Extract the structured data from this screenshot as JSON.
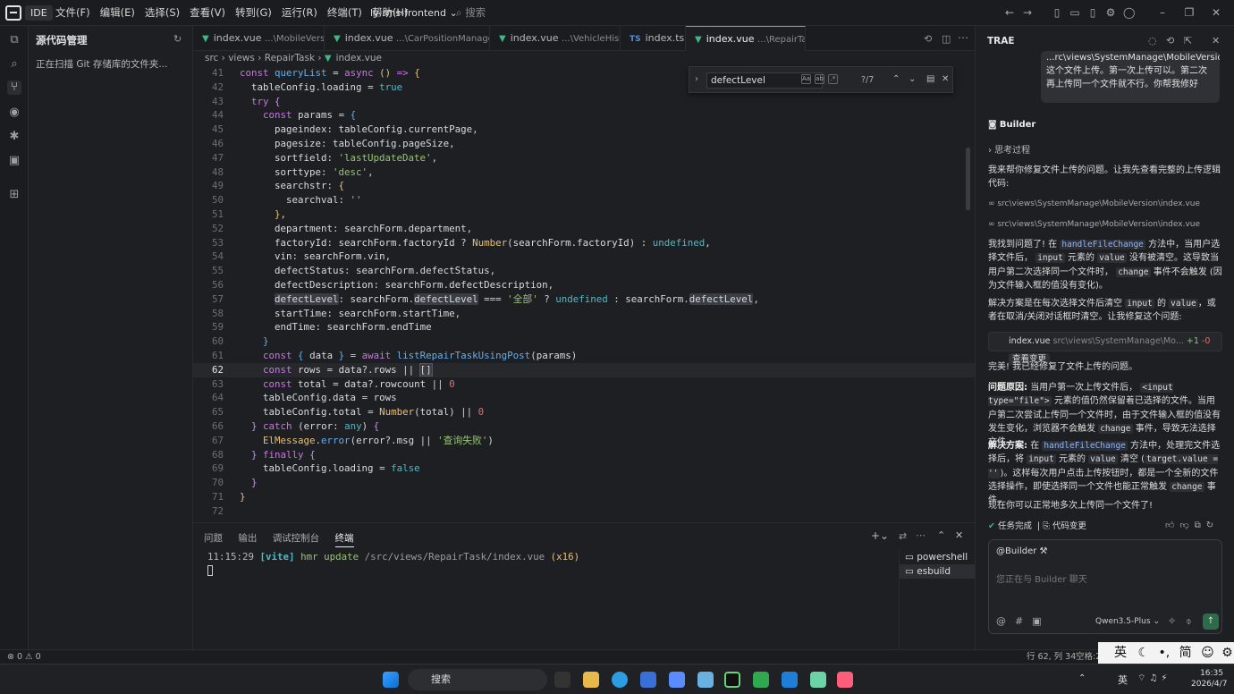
{
  "titlebar": {
    "badge": "IDE",
    "menu": [
      "文件(F)",
      "编辑(E)",
      "选择(S)",
      "查看(V)",
      "转到(G)",
      "运行(R)",
      "终端(T)",
      "帮助(H)"
    ],
    "project": "ly-rms-frontend",
    "search_placeholder": "搜索"
  },
  "sidebar": {
    "title": "源代码管理",
    "message": "正在扫描 Git 存储库的文件夹..."
  },
  "tabs": [
    {
      "name": "index.vue",
      "hint": "...\\MobileVersion",
      "type": "vue"
    },
    {
      "name": "index.vue",
      "hint": "...\\CarPositionManagement",
      "type": "vue"
    },
    {
      "name": "index.vue",
      "hint": "...\\VehicleHistory",
      "type": "vue"
    },
    {
      "name": "index.ts",
      "hint": "",
      "type": "ts"
    },
    {
      "name": "index.vue",
      "hint": "...\\RepairTask",
      "type": "vue",
      "active": true
    }
  ],
  "breadcrumb": [
    "src",
    "views",
    "RepairTask",
    "index.vue"
  ],
  "find": {
    "query": "defectLevel",
    "count": "?/7"
  },
  "editor": {
    "current_line": 62,
    "lines": [
      {
        "n": 41,
        "html": "<span class='k'>const</span> <span class='f'>queryList</span> <span class='p'>=</span> <span class='k'>async</span> <span class='v'>()</span> <span class='k'>=&gt;</span> <span class='v'>{</span>"
      },
      {
        "n": 42,
        "html": "  <span class='pr'>tableConfig</span>.<span class='pr'>loading</span> = <span class='b'>true</span>"
      },
      {
        "n": 43,
        "html": "  <span class='k'>try</span> <span class='u'>{</span>"
      },
      {
        "n": 44,
        "html": "    <span class='k'>const</span> <span class='pr'>params</span> = <span class='f'>{</span>"
      },
      {
        "n": 45,
        "html": "      <span class='pr'>pageindex</span>: <span class='pr'>tableConfig</span>.<span class='pr'>currentPage</span>,"
      },
      {
        "n": 46,
        "html": "      <span class='pr'>pagesize</span>: <span class='pr'>tableConfig</span>.<span class='pr'>pageSize</span>,"
      },
      {
        "n": 47,
        "html": "      <span class='pr'>sortfield</span>: <span class='s'>'lastUpdateDate'</span>,"
      },
      {
        "n": 48,
        "html": "      <span class='pr'>sorttype</span>: <span class='s'>'desc'</span>,"
      },
      {
        "n": 49,
        "html": "      <span class='pr'>searchstr</span>: <span class='v'>{</span>"
      },
      {
        "n": 50,
        "html": "        <span class='pr'>searchval</span>: <span class='s'>''</span>"
      },
      {
        "n": 51,
        "html": "      <span class='v'>}</span>,"
      },
      {
        "n": 52,
        "html": "      <span class='pr'>department</span>: <span class='pr'>searchForm</span>.<span class='pr'>department</span>,"
      },
      {
        "n": 53,
        "html": "      <span class='pr'>factoryId</span>: <span class='pr'>searchForm</span>.<span class='pr'>factoryId</span> ? <span class='v'>Number</span>(<span class='pr'>searchForm</span>.<span class='pr'>factoryId</span>) : <span class='b'>undefined</span>,"
      },
      {
        "n": 54,
        "html": "      <span class='pr'>vin</span>: <span class='pr'>searchForm</span>.<span class='pr'>vin</span>,"
      },
      {
        "n": 55,
        "html": "      <span class='pr'>defectStatus</span>: <span class='pr'>searchForm</span>.<span class='pr'>defectStatus</span>,"
      },
      {
        "n": 56,
        "html": "      <span class='pr'>defectDescription</span>: <span class='pr'>searchForm</span>.<span class='pr'>defectDescription</span>,"
      },
      {
        "n": 57,
        "html": "      <span class='pr hl'>defectLevel</span>: <span class='pr'>searchForm</span>.<span class='pr hl'>defectLevel</span> === <span class='s'>'全部'</span> ? <span class='b'>undefined</span> : <span class='pr'>searchForm</span>.<span class='pr hl'>defectLevel</span>,"
      },
      {
        "n": 58,
        "html": "      <span class='pr'>startTime</span>: <span class='pr'>searchForm</span>.<span class='pr'>startTime</span>,"
      },
      {
        "n": 59,
        "html": "      <span class='pr'>endTime</span>: <span class='pr'>searchForm</span>.<span class='pr'>endTime</span>"
      },
      {
        "n": 60,
        "html": "    <span class='f'>}</span>"
      },
      {
        "n": 61,
        "html": "    <span class='k'>const</span> <span class='f'>{</span> <span class='pr'>data</span> <span class='f'>}</span> = <span class='k'>await</span> <span class='f'>listRepairTaskUsingPost</span>(<span class='pr'>params</span>)"
      },
      {
        "n": 62,
        "html": "    <span class='k'>const</span> <span class='pr'>rows</span> = <span class='pr'>data</span>?.<span class='pr'>rows</span> || <span class='hl2'>[]</span>"
      },
      {
        "n": 63,
        "html": "    <span class='k'>const</span> <span class='pr'>total</span> = <span class='pr'>data</span>?.<span class='pr'>rowcount</span> || <span class='n'>0</span>"
      },
      {
        "n": 64,
        "html": "    <span class='pr'>tableConfig</span>.<span class='pr'>data</span> = <span class='pr'>rows</span>"
      },
      {
        "n": 65,
        "html": "    <span class='pr'>tableConfig</span>.<span class='pr'>total</span> = <span class='v'>Number</span>(<span class='pr'>total</span>) || <span class='n'>0</span>"
      },
      {
        "n": 66,
        "html": "  <span class='u'>}</span> <span class='k'>catch</span> (<span class='pr'>error</span>: <span class='b'>any</span>) <span class='u'>{</span>"
      },
      {
        "n": 67,
        "html": "    <span class='v'>ElMessage</span>.<span class='f'>error</span>(<span class='pr'>error</span>?.<span class='pr'>msg</span> || <span class='s'>'查询失败'</span>)"
      },
      {
        "n": 68,
        "html": "  <span class='u'>}</span> <span class='k'>finally</span> <span class='u'>{</span>"
      },
      {
        "n": 69,
        "html": "    <span class='pr'>tableConfig</span>.<span class='pr'>loading</span> = <span class='b'>false</span>"
      },
      {
        "n": 70,
        "html": "  <span class='u'>}</span>"
      },
      {
        "n": 71,
        "html": "<span class='v'>}</span>"
      },
      {
        "n": 72,
        "html": ""
      }
    ]
  },
  "panel": {
    "tabs": [
      "问题",
      "输出",
      "调试控制台",
      "终端"
    ],
    "active_tab": "终端",
    "terminal_time": "11:15:29",
    "terminal_tag": "[vite]",
    "terminal_msg": "hmr update",
    "terminal_path": "/src/views/RepairTask/index.vue",
    "terminal_count": "(x16)",
    "terminals": [
      "powershell",
      "esbuild"
    ]
  },
  "chat": {
    "title": "TRAE",
    "user_message": "...rc\\views\\SystemManage\\MobileVersion\\index.vue这个文件上传。第一次上传可以。第二次再上传同一个文件就不行。你帮我修好",
    "agent": "Builder",
    "thinking": "思考过程",
    "intro": "我来帮你修复文件上传的问题。让我先查看完整的上传逻辑代码:",
    "ref1": "src\\views\\SystemManage\\MobileVersion\\index.vue",
    "ref2": "src\\views\\SystemManage\\MobileVersion\\index.vue",
    "found_prefix": "我找到问题了! 在",
    "found_fn": "handleFileChange",
    "found_mid1": "方法中，当用户选择文件后，",
    "found_input": "input",
    "found_mid2": "元素的",
    "found_value": "value",
    "found_mid3": "没有被清空。这导致当用户第二次选择同一个文件时，",
    "found_change": "change",
    "found_end": "事件不会触发 (因为文件输入框的值没有变化)。",
    "solution1": "解决方案是在每次选择文件后清空",
    "solution_input": "input",
    "solution_mid": "的",
    "solution_value": "value",
    "solution_end": "，或者在取消/关闭对话框时清空。让我修复这个问题:",
    "change_file": "index.vue",
    "change_path": "src\\views\\SystemManage\\Mo...",
    "change_add": "+1",
    "change_del": "-0",
    "change_btn": "查看变更",
    "done": "完美! 我已经修复了文件上传的问题。",
    "cause_label": "问题原因:",
    "cause1": "当用户第一次上传文件后，",
    "cause_code": "<input type=\"file\">",
    "cause2": "元素的值仍然保留着已选择的文件。当用户第二次尝试上传同一个文件时，由于文件输入框的值没有发生变化，浏览器不会触发",
    "cause_change": "change",
    "cause3": "事件，导致无法选择文件。",
    "fix_label": "解决方案:",
    "fix1": "在",
    "fix_fn": "handleFileChange",
    "fix2": "方法中，处理完文件选择后，将",
    "fix_input": "input",
    "fix3": "元素的",
    "fix_value": "value",
    "fix4": "清空 (",
    "fix_code": "target.value = ''",
    "fix5": ")。这样每次用户点击上传按钮时，都是一个全新的文件选择操作，即使选择同一个文件也能正常触发",
    "fix_change": "change",
    "fix6": "事件。",
    "final": "现在你可以正常地多次上传同一个文件了!",
    "task_done": "任务完成",
    "code_change": "代码变更",
    "mention": "@Builder",
    "input_placeholder": "您正在与 Builder 聊天",
    "model": "Qwen3.5-Plus"
  },
  "statusbar": {
    "errors": "0",
    "warnings": "0",
    "position": "行 62, 列 34",
    "spaces": "空格:2"
  },
  "taskbar": {
    "search": "搜索",
    "lang": "英",
    "time": "16:35",
    "date": "2026/4/7"
  },
  "ime": {
    "lang": "英",
    "mode": "简"
  }
}
